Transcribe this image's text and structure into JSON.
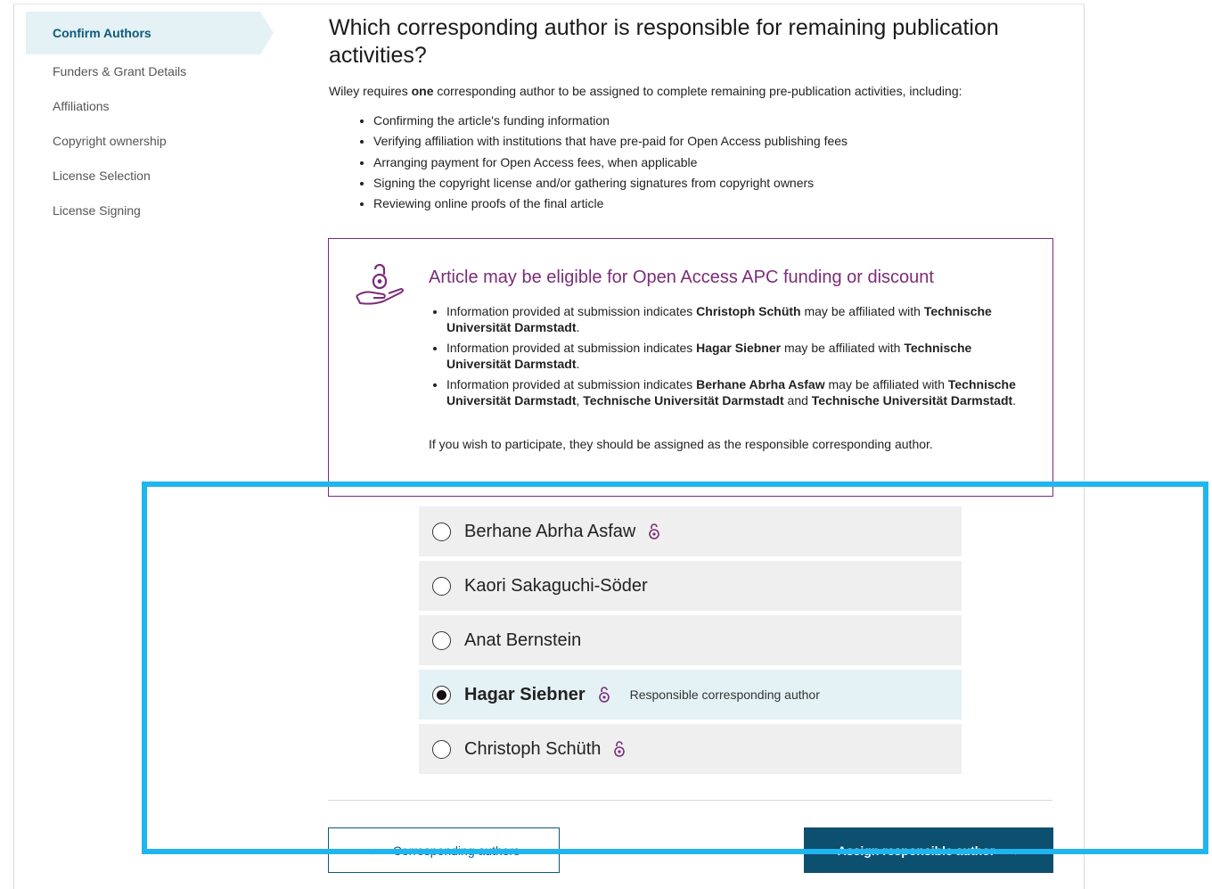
{
  "sidebar": {
    "items": [
      {
        "label": "Confirm Authors",
        "active": true
      },
      {
        "label": "Funders & Grant Details"
      },
      {
        "label": "Affiliations"
      },
      {
        "label": "Copyright ownership"
      },
      {
        "label": "License Selection"
      },
      {
        "label": "License Signing"
      }
    ]
  },
  "main": {
    "title": "Which corresponding author is responsible for remaining publication activities?",
    "intro_pre": "Wiley requires ",
    "intro_bold": "one",
    "intro_post": " corresponding author to be assigned to complete remaining pre-publication activities, including:",
    "bullets": [
      "Confirming the article's funding information",
      "Verifying affiliation with institutions that have pre-paid for Open Access publishing fees",
      "Arranging payment for Open Access fees, when applicable",
      "Signing the copyright license and/or gathering signatures from copyright owners",
      "Reviewing online proofs of the final article"
    ]
  },
  "oa_box": {
    "icon": "open-lock-hand-icon",
    "heading": "Article may be eligible for Open Access APC funding or discount",
    "prefix": "Information provided at submission indicates ",
    "mid": " may be affiliated with ",
    "and": " and ",
    "comma": ", ",
    "period": ".",
    "items": [
      {
        "author": "Christoph Schüth",
        "institutions": [
          "Technische Universität Darmstadt"
        ]
      },
      {
        "author": "Hagar Siebner",
        "institutions": [
          "Technische Universität Darmstadt"
        ]
      },
      {
        "author": "Berhane Abrha Asfaw",
        "institutions": [
          "Technische Universität Darmstadt",
          "Technische Universität Darmstadt",
          "Technische Universität Darmstadt"
        ]
      }
    ],
    "footer": "If you wish to participate, they should be assigned as the responsible corresponding author."
  },
  "choices": [
    {
      "name": "Berhane Abrha Asfaw",
      "open_access": true,
      "selected": false
    },
    {
      "name": "Kaori Sakaguchi-Söder",
      "open_access": false,
      "selected": false
    },
    {
      "name": "Anat Bernstein",
      "open_access": false,
      "selected": false
    },
    {
      "name": "Hagar Siebner",
      "open_access": true,
      "selected": true,
      "note": "Responsible corresponding author"
    },
    {
      "name": "Christoph Schüth",
      "open_access": true,
      "selected": false
    }
  ],
  "buttons": {
    "back_label": "Corresponding authors",
    "back_icon": "arrow-left-icon",
    "next_label": "Assign responsible author",
    "next_icon": "arrow-right-icon"
  },
  "colors": {
    "accent_purple": "#7b2c7a",
    "primary_blue": "#0d4f6f",
    "highlight_cyan": "#1fb6f0",
    "selected_bg": "#e4f1f5"
  }
}
